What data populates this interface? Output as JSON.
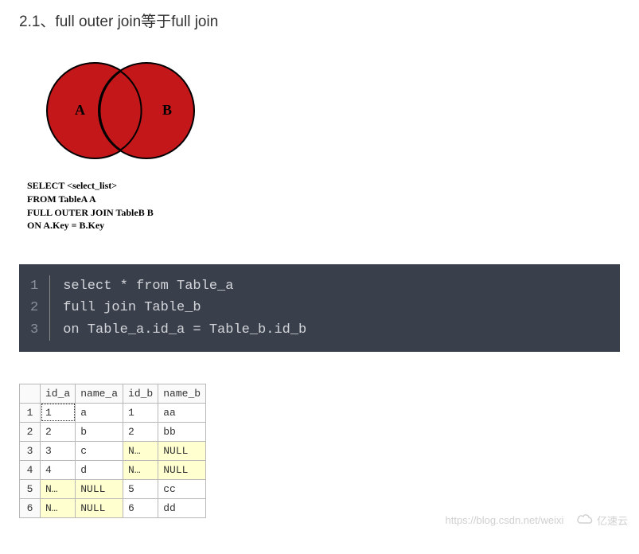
{
  "heading": "2.1、full outer join等于full join",
  "venn": {
    "labelA": "A",
    "labelB": "B",
    "color": "#c4171a",
    "caption_lines": [
      "SELECT <select_list>",
      "FROM TableA A",
      "FULL OUTER JOIN TableB B",
      "ON A.Key = B.Key"
    ]
  },
  "code": {
    "line_numbers": [
      "1",
      "2",
      "3"
    ],
    "lines": [
      "select * from Table_a",
      "full join Table_b",
      "on Table_a.id_a = Table_b.id_b"
    ]
  },
  "result": {
    "headers": [
      "id_a",
      "name_a",
      "id_b",
      "name_b"
    ],
    "rows": [
      {
        "n": "1",
        "id_a": "1",
        "name_a": "a",
        "id_b": "1",
        "name_b": "aa",
        "null_a": false,
        "null_b": false,
        "sel": true
      },
      {
        "n": "2",
        "id_a": "2",
        "name_a": "b",
        "id_b": "2",
        "name_b": "bb",
        "null_a": false,
        "null_b": false,
        "sel": false
      },
      {
        "n": "3",
        "id_a": "3",
        "name_a": "c",
        "id_b": "N…",
        "name_b": "NULL",
        "null_a": false,
        "null_b": true,
        "sel": false
      },
      {
        "n": "4",
        "id_a": "4",
        "name_a": "d",
        "id_b": "N…",
        "name_b": "NULL",
        "null_a": false,
        "null_b": true,
        "sel": false
      },
      {
        "n": "5",
        "id_a": "N…",
        "name_a": "NULL",
        "id_b": "5",
        "name_b": "cc",
        "null_a": true,
        "null_b": false,
        "sel": false
      },
      {
        "n": "6",
        "id_a": "N…",
        "name_a": "NULL",
        "id_b": "6",
        "name_b": "dd",
        "null_a": true,
        "null_b": false,
        "sel": false
      }
    ]
  },
  "watermark": {
    "url": "https://blog.csdn.net/weixi",
    "brand": "亿速云"
  },
  "chart_data": {
    "type": "table",
    "title": "full outer join result of Table_a and Table_b",
    "columns": [
      "id_a",
      "name_a",
      "id_b",
      "name_b"
    ],
    "rows": [
      [
        1,
        "a",
        1,
        "aa"
      ],
      [
        2,
        "b",
        2,
        "bb"
      ],
      [
        3,
        "c",
        null,
        null
      ],
      [
        4,
        "d",
        null,
        null
      ],
      [
        null,
        null,
        5,
        "cc"
      ],
      [
        null,
        null,
        6,
        "dd"
      ]
    ]
  }
}
